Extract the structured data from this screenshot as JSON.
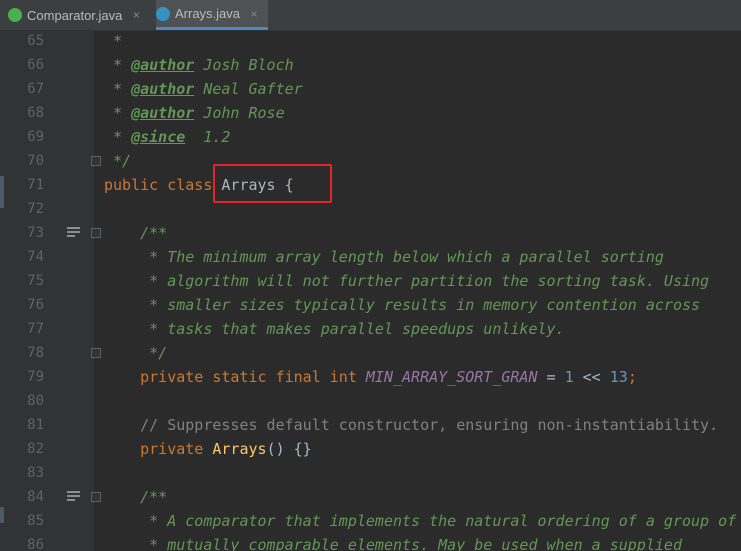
{
  "tabs": [
    {
      "label": "Comparator.java",
      "icon": "java-interface-icon",
      "icon_color": "#4caf50",
      "active": false
    },
    {
      "label": "Arrays.java",
      "icon": "java-class-icon",
      "icon_color": "#3592c4",
      "active": true
    }
  ],
  "close_glyph": "×",
  "colors": {
    "background": "#2b2b2b",
    "gutter": "#313335",
    "comment": "#629755",
    "keyword": "#cc7832",
    "text": "#a9b7c6",
    "constant": "#9876aa",
    "number": "#6897bb",
    "highlight_border": "#e0262b"
  },
  "lines": [
    {
      "num": "65",
      "segments": [
        {
          "c": "comment",
          "t": " *"
        }
      ]
    },
    {
      "num": "66",
      "segments": [
        {
          "c": "comment",
          "t": " * "
        },
        {
          "c": "tag",
          "t": "@author"
        },
        {
          "c": "comment",
          "t": " Josh Bloch"
        }
      ]
    },
    {
      "num": "67",
      "segments": [
        {
          "c": "comment",
          "t": " * "
        },
        {
          "c": "tag",
          "t": "@author"
        },
        {
          "c": "comment",
          "t": " Neal Gafter"
        }
      ]
    },
    {
      "num": "68",
      "segments": [
        {
          "c": "comment",
          "t": " * "
        },
        {
          "c": "tag",
          "t": "@author"
        },
        {
          "c": "comment",
          "t": " John Rose"
        }
      ]
    },
    {
      "num": "69",
      "segments": [
        {
          "c": "comment",
          "t": " * "
        },
        {
          "c": "tag",
          "t": "@since"
        },
        {
          "c": "comment",
          "t": "  1.2"
        }
      ]
    },
    {
      "num": "70",
      "segments": [
        {
          "c": "comment",
          "t": " */"
        }
      ]
    },
    {
      "num": "71",
      "segments": [
        {
          "c": "kw",
          "t": "public class "
        },
        {
          "c": "plain",
          "t": "Arrays {"
        }
      ]
    },
    {
      "num": "72",
      "segments": []
    },
    {
      "num": "73",
      "segments": [
        {
          "c": "comment",
          "t": "    /**"
        }
      ]
    },
    {
      "num": "74",
      "segments": [
        {
          "c": "comment",
          "t": "     * The minimum array length below which a parallel sorting"
        }
      ]
    },
    {
      "num": "75",
      "segments": [
        {
          "c": "comment",
          "t": "     * algorithm will not further partition the sorting task. Using"
        }
      ]
    },
    {
      "num": "76",
      "segments": [
        {
          "c": "comment",
          "t": "     * smaller sizes typically results in memory contention across"
        }
      ]
    },
    {
      "num": "77",
      "segments": [
        {
          "c": "comment",
          "t": "     * tasks that makes parallel speedups unlikely."
        }
      ]
    },
    {
      "num": "78",
      "segments": [
        {
          "c": "comment",
          "t": "     */"
        }
      ]
    },
    {
      "num": "79",
      "segments": [
        {
          "c": "kw",
          "t": "    private static final int "
        },
        {
          "c": "const",
          "t": "MIN_ARRAY_SORT_GRAN"
        },
        {
          "c": "plain",
          "t": " = "
        },
        {
          "c": "num",
          "t": "1"
        },
        {
          "c": "plain",
          "t": " << "
        },
        {
          "c": "num",
          "t": "13"
        },
        {
          "c": "kw",
          "t": ";"
        }
      ]
    },
    {
      "num": "80",
      "segments": []
    },
    {
      "num": "81",
      "segments": [
        {
          "c": "lcomment",
          "t": "    // Suppresses default constructor, ensuring non-instantiability."
        }
      ]
    },
    {
      "num": "82",
      "segments": [
        {
          "c": "kw",
          "t": "    private "
        },
        {
          "c": "method",
          "t": "Arrays"
        },
        {
          "c": "plain",
          "t": "() {}"
        }
      ]
    },
    {
      "num": "83",
      "segments": []
    },
    {
      "num": "84",
      "segments": [
        {
          "c": "comment",
          "t": "    /**"
        }
      ]
    },
    {
      "num": "85",
      "segments": [
        {
          "c": "comment",
          "t": "     * A comparator that implements the natural ordering of a group of"
        }
      ]
    },
    {
      "num": "86",
      "segments": [
        {
          "c": "comment",
          "t": "     * mutually comparable elements. May be used when a supplied"
        }
      ]
    }
  ]
}
